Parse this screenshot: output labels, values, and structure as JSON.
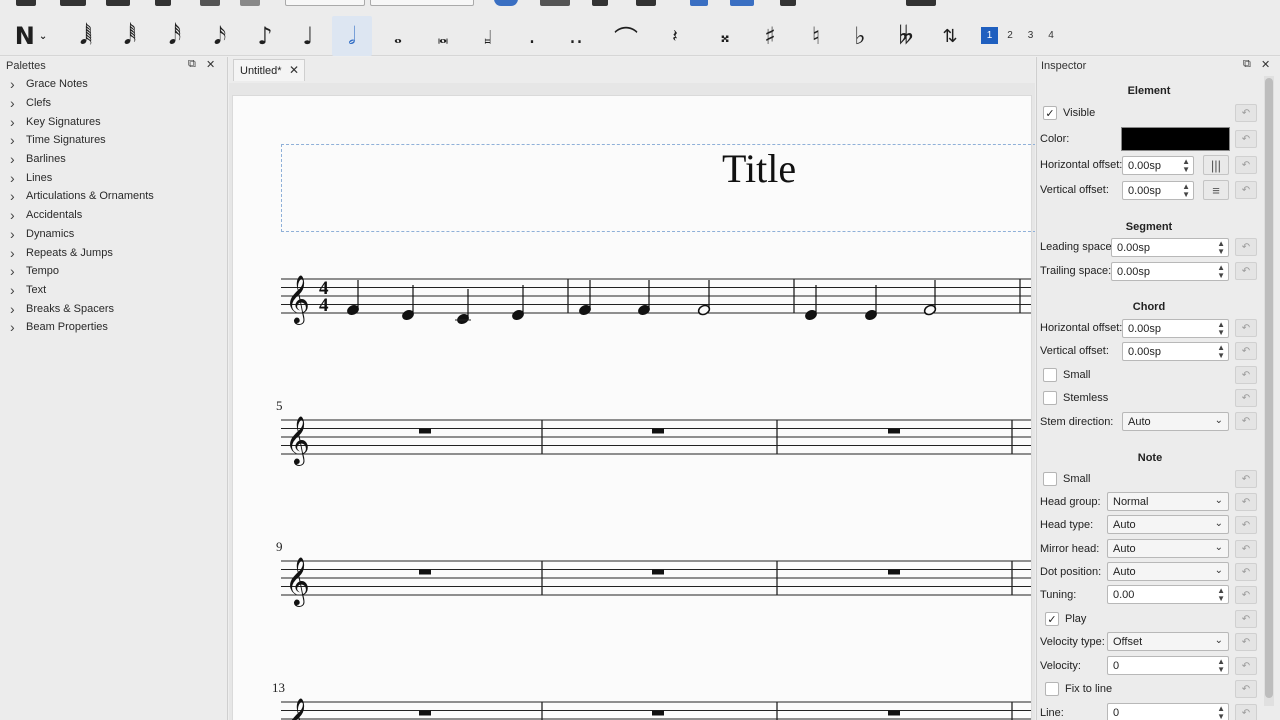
{
  "toolbar": {
    "note_input_icon": "N",
    "durations": [
      {
        "name": "128th-note-icon",
        "glyph": "𝅘𝅥𝅲"
      },
      {
        "name": "64th-note-icon",
        "glyph": "𝅘𝅥𝅱"
      },
      {
        "name": "32nd-note-icon",
        "glyph": "𝅘𝅥𝅰"
      },
      {
        "name": "16th-note-icon",
        "glyph": "𝅘𝅥𝅯"
      },
      {
        "name": "eighth-note-icon",
        "glyph": "♪"
      },
      {
        "name": "quarter-note-icon",
        "glyph": "♩"
      },
      {
        "name": "half-note-icon",
        "glyph": "𝅗𝅥"
      },
      {
        "name": "whole-note-icon",
        "glyph": "𝅝"
      },
      {
        "name": "double-whole-note-icon",
        "glyph": "𝅜"
      },
      {
        "name": "longa-icon",
        "glyph": "𝆷"
      }
    ],
    "voices": [
      "1",
      "2",
      "3",
      "4"
    ]
  },
  "palettes": {
    "title": "Palettes",
    "items": [
      "Grace Notes",
      "Clefs",
      "Key Signatures",
      "Time Signatures",
      "Barlines",
      "Lines",
      "Articulations & Ornaments",
      "Accidentals",
      "Dynamics",
      "Repeats & Jumps",
      "Tempo",
      "Text",
      "Breaks & Spacers",
      "Beam Properties"
    ]
  },
  "score": {
    "tab_label": "Untitled*",
    "title": "Title",
    "measure_numbers": [
      "5",
      "9",
      "13"
    ],
    "time_signature": {
      "top": "4",
      "bottom": "4"
    }
  },
  "inspector": {
    "title": "Inspector",
    "element": {
      "heading": "Element",
      "visible_label": "Visible",
      "color_label": "Color:",
      "color_value": "#000000",
      "h_offset_label": "Horizontal offset:",
      "h_offset": "0.00sp",
      "v_offset_label": "Vertical offset:",
      "v_offset": "0.00sp"
    },
    "segment": {
      "heading": "Segment",
      "leading_label": "Leading space:",
      "leading": "0.00sp",
      "trailing_label": "Trailing space:",
      "trailing": "0.00sp"
    },
    "chord": {
      "heading": "Chord",
      "h_offset_label": "Horizontal offset:",
      "h_offset": "0.00sp",
      "v_offset_label": "Vertical offset:",
      "v_offset": "0.00sp",
      "small_label": "Small",
      "stemless_label": "Stemless",
      "stem_dir_label": "Stem direction:",
      "stem_dir": "Auto"
    },
    "note": {
      "heading": "Note",
      "small_label": "Small",
      "head_group_label": "Head group:",
      "head_group": "Normal",
      "head_type_label": "Head type:",
      "head_type": "Auto",
      "mirror_label": "Mirror head:",
      "mirror": "Auto",
      "dot_label": "Dot position:",
      "dot": "Auto",
      "tuning_label": "Tuning:",
      "tuning": "0.00",
      "play_label": "Play",
      "velocity_type_label": "Velocity type:",
      "velocity_type": "Offset",
      "velocity_label": "Velocity:",
      "velocity": "0",
      "fix_label": "Fix to line",
      "line_label": "Line:",
      "line": "0"
    }
  }
}
